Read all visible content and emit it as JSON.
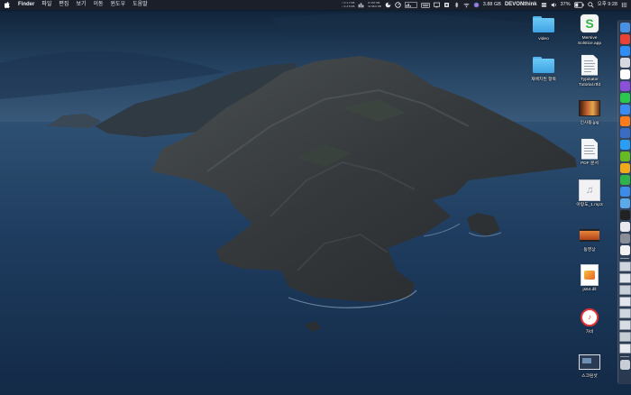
{
  "menubar": {
    "apple_icon": "apple-logo-icon",
    "app_name": "Finder",
    "menus": [
      "파일",
      "편집",
      "보기",
      "이동",
      "윈도우",
      "도움말"
    ],
    "stats": {
      "net_top": "↑ 1/ 1.7 KB",
      "net_bottom": "↓ 1/ 4.5 KB",
      "disk_top": "R 197 KB",
      "disk_bottom": "W 68.6 KB"
    },
    "memory": "3.88 GB",
    "devonthink": "DEVONthink",
    "battery": "37%",
    "clock": "오후 9:28",
    "icons": [
      "pie-chart-icon",
      "network-status-icon",
      "gauge-icon",
      "cpu-graph-icon",
      "keyboard-icon",
      "display-icon",
      "memory-chip-icon",
      "bluetooth-icon",
      "wifi-icon",
      "volume-icon",
      "battery-icon",
      "search-icon",
      "siri-icon",
      "control-center-icon"
    ]
  },
  "desktop": {
    "items": [
      {
        "label": "video",
        "icon": "folder-icon"
      },
      {
        "label": "Mersive Solstice.app",
        "icon": "app-icon"
      },
      {
        "label": "재배치된 항목",
        "icon": "folder-icon"
      },
      {
        "label": "Typinator Tutorial.rtfd",
        "icon": "document-icon"
      },
      {
        "label": "인사동.jpg",
        "icon": "image-icon"
      },
      {
        "label": "PDF 문서",
        "icon": "pdf-icon"
      },
      {
        "label": "아랑도_1.mp3",
        "icon": "music-file-icon"
      },
      {
        "label": "동영상",
        "icon": "video-icon"
      },
      {
        "label": "js64.dll",
        "icon": "dll-icon"
      },
      {
        "label": "가비",
        "icon": "audio-file-icon"
      },
      {
        "label": "스크린샷",
        "icon": "screenshot-icon"
      }
    ]
  },
  "dock": {
    "items": [
      {
        "icon": "finder-icon",
        "color": "#4a90e2"
      },
      {
        "icon": "chrome-icon",
        "color": "#e94235"
      },
      {
        "icon": "safari-icon",
        "color": "#2f8ef5"
      },
      {
        "icon": "launchpad-icon",
        "color": "#d7d9e0"
      },
      {
        "icon": "calendar-icon",
        "color": "#ffffff"
      },
      {
        "icon": "omnifocus-icon",
        "color": "#8c4fd8"
      },
      {
        "icon": "messages-icon",
        "color": "#2cc84d"
      },
      {
        "icon": "mail-icon",
        "color": "#3b8cf2"
      },
      {
        "icon": "firefox-icon",
        "color": "#ff7b1b"
      },
      {
        "icon": "dictionary-icon",
        "color": "#3b6cc4"
      },
      {
        "icon": "keynote-icon",
        "color": "#2a9df4"
      },
      {
        "icon": "tes-icon",
        "color": "#66bb22"
      },
      {
        "icon": "tweetbot-icon",
        "color": "#f0a91a"
      },
      {
        "icon": "evernote-icon",
        "color": "#30b24a"
      },
      {
        "icon": "music-icon",
        "color": "#3c8ce8"
      },
      {
        "icon": "preview-icon",
        "color": "#5da8e8"
      },
      {
        "icon": "terminal-icon",
        "color": "#222222"
      },
      {
        "icon": "slack-icon",
        "color": "#e8e8ee"
      },
      {
        "icon": "preferences-icon",
        "color": "#8a8e96"
      },
      {
        "icon": "photos-icon",
        "color": "#f2f2f2"
      },
      {
        "icon": "window-thumbnail-icon",
        "color": "#d0d6de"
      },
      {
        "icon": "window-thumbnail-icon",
        "color": "#dfe4ea"
      },
      {
        "icon": "window-thumbnail-icon",
        "color": "#c8d0da"
      },
      {
        "icon": "window-thumbnail-icon",
        "color": "#e2e6ec"
      },
      {
        "icon": "window-thumbnail-icon",
        "color": "#cfd6de"
      },
      {
        "icon": "window-thumbnail-icon",
        "color": "#d8dde4"
      },
      {
        "icon": "window-thumbnail-icon",
        "color": "#c6ccd4"
      },
      {
        "icon": "window-thumbnail-icon",
        "color": "#e6e9ee"
      },
      {
        "icon": "trash-icon",
        "color": "#c9ced6"
      }
    ]
  },
  "colors": {
    "sky_top": "#0f2238",
    "sea": "#1e3a5c",
    "island": "#3a3f44",
    "folder_blue": "#4fb3ef"
  }
}
